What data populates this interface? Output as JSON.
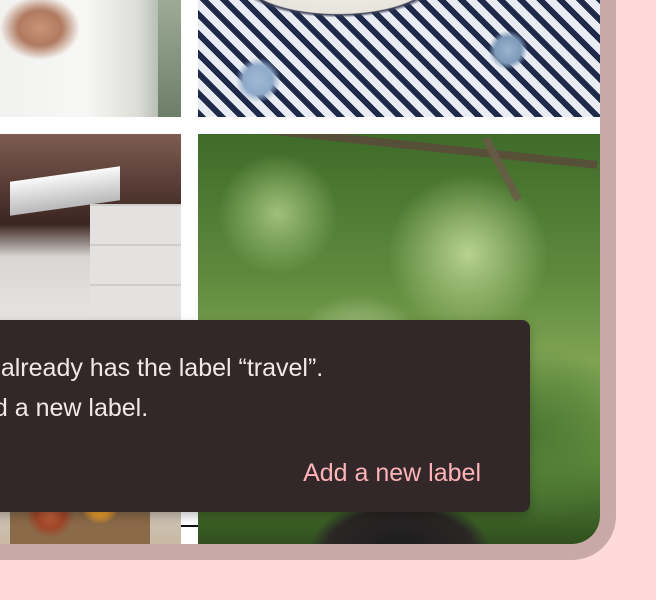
{
  "snackbar": {
    "message_line1": "o already has the label “travel”.",
    "message_line2": "dd a new label.",
    "action_label": "Add a new label"
  },
  "colors": {
    "background": "#ffdad9",
    "device_frame": "#c9a8a8",
    "snackbar_surface": "#322829",
    "snackbar_text": "#f3e8e8",
    "snackbar_action": "#ffb3b6"
  }
}
